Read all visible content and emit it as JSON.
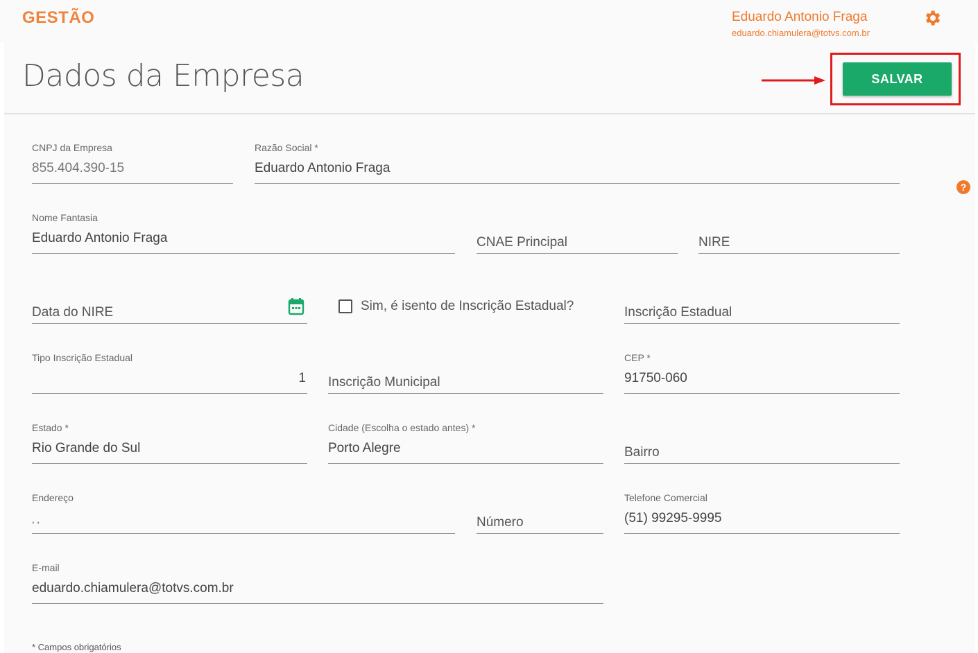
{
  "header": {
    "brand": "GESTÃO",
    "user_name": "Eduardo Antonio Fraga",
    "user_email": "eduardo.chiamulera@totvs.com.br"
  },
  "page": {
    "title": "Dados da Empresa",
    "save_label": "SALVAR",
    "help_glyph": "?",
    "footnote": "* Campos obrigatórios"
  },
  "form": {
    "cnpj": {
      "label": "CNPJ da Empresa",
      "value": "855.404.390-15"
    },
    "razao_social": {
      "label": "Razão Social *",
      "value": "Eduardo Antonio Fraga"
    },
    "nome_fantasia": {
      "label": "Nome Fantasia",
      "value": "Eduardo Antonio Fraga"
    },
    "cnae": {
      "placeholder": "CNAE Principal"
    },
    "nire": {
      "placeholder": "NIRE"
    },
    "data_nire": {
      "placeholder": "Data do NIRE"
    },
    "isento_ie": {
      "label": "Sim, é isento de Inscrição Estadual?",
      "checked": false
    },
    "inscricao_estadual": {
      "placeholder": "Inscrição Estadual"
    },
    "tipo_ie": {
      "label": "Tipo Inscrição Estadual",
      "value": "1"
    },
    "inscricao_municipal": {
      "placeholder": "Inscrição Municipal"
    },
    "cep": {
      "label": "CEP *",
      "value": "91750-060"
    },
    "estado": {
      "label": "Estado *",
      "value": "Rio Grande do Sul"
    },
    "cidade": {
      "label": "Cidade (Escolha o estado antes) *",
      "value": "Porto Alegre"
    },
    "bairro": {
      "placeholder": "Bairro"
    },
    "endereco": {
      "label": "Endereço",
      "value": ", ,"
    },
    "numero": {
      "placeholder": "Número"
    },
    "telefone": {
      "label": "Telefone Comercial",
      "value": "(51) 99295-9995"
    },
    "email": {
      "label": "E-mail",
      "value": "eduardo.chiamulera@totvs.com.br"
    }
  },
  "colors": {
    "brand": "#f0843c",
    "save_button": "#1ba96a",
    "highlight": "#e01b1b",
    "calendar_icon": "#1ba96a"
  },
  "icons": [
    "gear-icon",
    "calendar-icon",
    "help-icon",
    "arrow-icon"
  ]
}
